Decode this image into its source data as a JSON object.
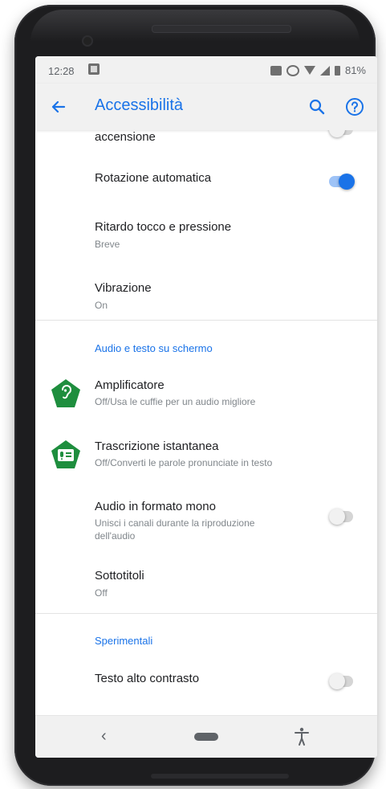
{
  "status_bar": {
    "time": "12:28",
    "battery": "81%",
    "icons": [
      "image-icon",
      "nfc-icon",
      "vibrate-icon",
      "wifi-icon",
      "signal-icon",
      "battery-icon"
    ]
  },
  "app_bar": {
    "title": "Accessibilità",
    "icons": [
      "back-arrow-icon",
      "search-icon",
      "help-icon"
    ]
  },
  "settings": {
    "partial_item": {
      "title": "accensione",
      "toggle": "off"
    },
    "rotation": {
      "title": "Rotazione automatica",
      "toggle": "on"
    },
    "touch_delay": {
      "title": "Ritardo tocco e pressione",
      "subtitle": "Breve"
    },
    "vibration": {
      "title": "Vibrazione",
      "subtitle": "On"
    },
    "section_audio": "Audio e testo su schermo",
    "amplifier": {
      "title": "Amplificatore",
      "subtitle": "Off/Usa le cuffie per un audio migliore"
    },
    "live_transcribe": {
      "title": "Trascrizione istantanea",
      "subtitle": "Off/Converti le parole pronunciate in testo"
    },
    "mono_audio": {
      "title": "Audio in formato mono",
      "subtitle_line1": "Unisci i canali durante la riproduzione",
      "subtitle_line2": "dell'audio",
      "toggle": "off"
    },
    "captions": {
      "title": "Sottotitoli",
      "subtitle": "Off"
    },
    "section_experimental": "Sperimentali",
    "high_contrast": {
      "title": "Testo alto contrasto",
      "toggle": "off"
    }
  },
  "nav_bar": {
    "back": "‹",
    "icons": [
      "back-icon",
      "home-pill-icon",
      "accessibility-icon"
    ]
  },
  "colors": {
    "accent": "#1a73e8",
    "icon_green": "#1e8e3e",
    "text_primary": "#202124",
    "text_secondary": "#80868b"
  }
}
